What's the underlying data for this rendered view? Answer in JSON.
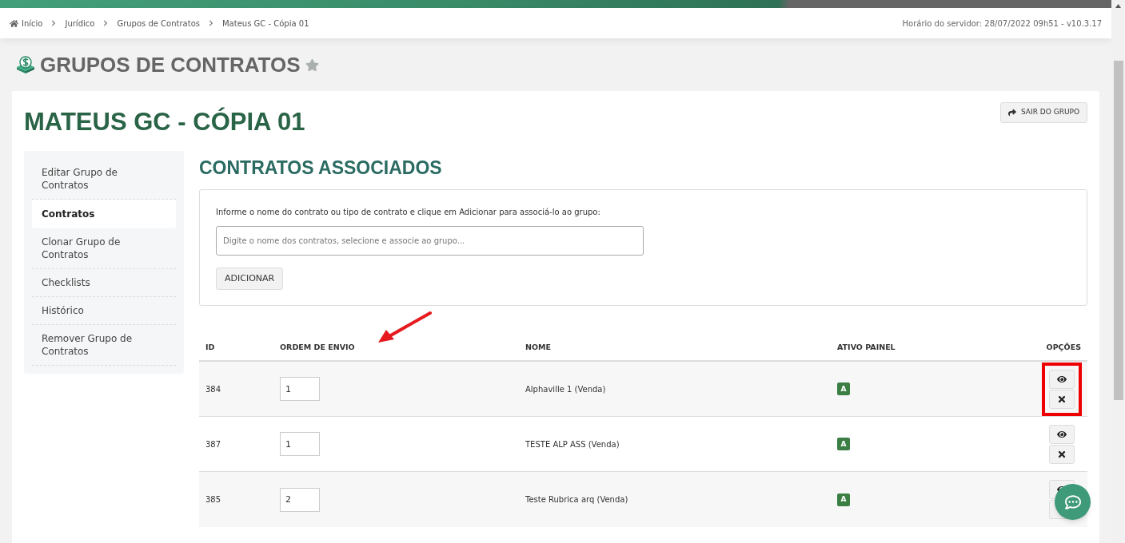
{
  "breadcrumb": [
    {
      "label": "Início",
      "kind": "home"
    },
    {
      "label": "Jurídico",
      "kind": "link"
    },
    {
      "label": "Grupos de Contratos",
      "kind": "link"
    },
    {
      "label": "Mateus GC - Cópia 01",
      "kind": "current"
    }
  ],
  "server_time": "Horário do servidor: 28/07/2022 09h51 - v10.3.17",
  "page_title": "GRUPOS DE CONTRATOS",
  "favorite": false,
  "group_title": "MATEUS GC - CÓPIA 01",
  "exit_button": "SAIR DO GRUPO",
  "sidebar": {
    "items": [
      {
        "label": "Editar Grupo de Contratos",
        "selected": false
      },
      {
        "label": "Contratos",
        "selected": true
      },
      {
        "label": "Clonar Grupo de Contratos",
        "selected": false
      },
      {
        "label": "Checklists",
        "selected": false
      },
      {
        "label": "Histórico",
        "selected": false
      },
      {
        "label": "Remover Grupo de Contratos",
        "selected": false
      }
    ]
  },
  "section_title": "CONTRATOS ASSOCIADOS",
  "add_panel": {
    "instructions": "Informe o nome do contrato ou tipo de contrato e clique em Adicionar para associá-lo ao grupo:",
    "placeholder": "Digite o nome dos contratos, selecione e associe ao grupo...",
    "button": "ADICIONAR"
  },
  "table": {
    "columns": [
      "ID",
      "ORDEM DE ENVIO",
      "NOME",
      "ATIVO PAINEL",
      "OPÇÕES"
    ],
    "rows": [
      {
        "id": "384",
        "order": "1",
        "name": "Alphaville 1 (Venda)",
        "active": "A",
        "highlighted": true
      },
      {
        "id": "387",
        "order": "1",
        "name": "TESTE ALP ASS (Venda)",
        "active": "A",
        "highlighted": false
      },
      {
        "id": "385",
        "order": "2",
        "name": "Teste Rubrica arq (Venda)",
        "active": "A",
        "highlighted": false
      }
    ]
  }
}
